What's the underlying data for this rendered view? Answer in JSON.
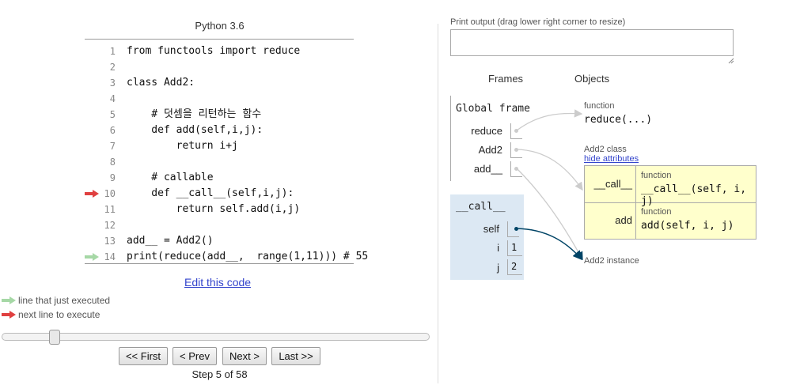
{
  "language": "Python 3.6",
  "code": [
    {
      "num": "1",
      "text": "from functools import reduce"
    },
    {
      "num": "2",
      "text": ""
    },
    {
      "num": "3",
      "text": "class Add2:"
    },
    {
      "num": "4",
      "text": ""
    },
    {
      "num": "5",
      "text": "    # 덧셈을 리턴하는 함수"
    },
    {
      "num": "6",
      "text": "    def add(self,i,j):"
    },
    {
      "num": "7",
      "text": "        return i+j"
    },
    {
      "num": "8",
      "text": ""
    },
    {
      "num": "9",
      "text": "    # callable"
    },
    {
      "num": "10",
      "text": "    def __call__(self,i,j):"
    },
    {
      "num": "11",
      "text": "        return self.add(i,j)"
    },
    {
      "num": "12",
      "text": ""
    },
    {
      "num": "13",
      "text": "add__ = Add2()"
    },
    {
      "num": "14",
      "text": "print(reduce(add__,  range(1,11))) # 55"
    }
  ],
  "edit_link": "Edit this code",
  "legend": {
    "just_executed": "line that just executed",
    "next_line": "next line to execute"
  },
  "nav": {
    "first": "<< First",
    "prev": "< Prev",
    "next": "Next >",
    "last": "Last >>",
    "step": "Step 5 of 58"
  },
  "progress": {
    "current_step": 5,
    "total_steps": 58
  },
  "print_output_label": "Print output (drag lower right corner to resize)",
  "frames_header": "Frames",
  "objects_header": "Objects",
  "global_frame": {
    "title": "Global frame",
    "vars": [
      "reduce",
      "Add2",
      "add__"
    ]
  },
  "call_frame": {
    "title": "__call__",
    "vars": [
      {
        "name": "self",
        "value": ""
      },
      {
        "name": "i",
        "value": "1"
      },
      {
        "name": "j",
        "value": "2"
      }
    ]
  },
  "objects": {
    "reduce_type": "function",
    "reduce_value": "reduce(...)",
    "class_type": "Add2 class",
    "hide_attributes": "hide attributes",
    "attrs": [
      {
        "name": "__call__",
        "type": "function",
        "value": "__call__(self, i, j)"
      },
      {
        "name": "add",
        "type": "function",
        "value": "add(self, i, j)"
      }
    ],
    "instance_label": "Add2 instance"
  },
  "colors": {
    "next_arrow": "#e04040",
    "executed_arrow": "#a6d8a6",
    "link": "#3344cc",
    "class_box": "#ffffcc",
    "frame_bg": "#dce8f3",
    "pointer_active": "#004466",
    "pointer_inactive": "#cccccc"
  }
}
